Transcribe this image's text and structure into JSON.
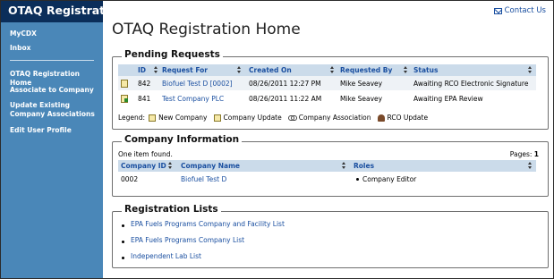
{
  "app": {
    "title": "OTAQ Registration",
    "contact_label": "Contact Us"
  },
  "sidebar": {
    "items": [
      {
        "label": "MyCDX"
      },
      {
        "label": "Inbox"
      },
      {
        "label": "OTAQ Registration Home"
      },
      {
        "label": "Associate to Company"
      },
      {
        "label": "Update Existing Company Associations"
      },
      {
        "label": "Edit User Profile"
      }
    ]
  },
  "main": {
    "title": "OTAQ Registration Home"
  },
  "pending": {
    "title": "Pending Requests",
    "columns": [
      "ID",
      "Request For",
      "Created On",
      "Requested By",
      "Status"
    ],
    "rows": [
      {
        "id": "842",
        "request_for": "Biofuel Test D [0002]",
        "created_on": "08/26/2011 12:27 PM",
        "requested_by": "Mike Seavey",
        "status": "Awaiting RCO Electronic Signature"
      },
      {
        "id": "841",
        "request_for": "Test Company PLC",
        "created_on": "08/26/2011 11:22 AM",
        "requested_by": "Mike Seavey",
        "status": "Awaiting EPA Review"
      }
    ],
    "legend_label": "Legend:",
    "legend": [
      "New Company",
      "Company Update",
      "Company Association",
      "RCO Update"
    ]
  },
  "company": {
    "title": "Company Information",
    "found_text": "One item found.",
    "pages_label": "Pages:",
    "pages_value": "1",
    "columns": [
      "Company ID",
      "Company Name",
      "Roles"
    ],
    "rows": [
      {
        "company_id": "0002",
        "company_name": "Biofuel Test D",
        "role": "Company Editor"
      }
    ]
  },
  "lists": {
    "title": "Registration Lists",
    "links": [
      "EPA Fuels Programs Company and Facility List",
      "EPA Fuels Programs Company List",
      "Independent Lab List"
    ]
  },
  "colors": {
    "sidebar": "#4a87b8",
    "header_dark": "#0b2e5a",
    "link": "#1a4fa0",
    "grid_header": "#cbdbea"
  }
}
